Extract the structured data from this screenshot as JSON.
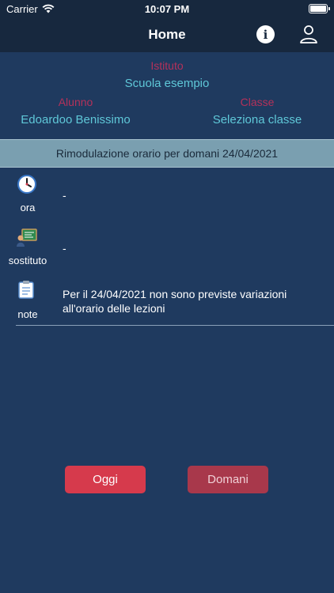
{
  "status_bar": {
    "carrier": "Carrier",
    "time": "10:07 PM"
  },
  "nav": {
    "title": "Home",
    "info_icon": "info-icon",
    "user_icon": "user-icon"
  },
  "header": {
    "istituto_label": "Istituto",
    "istituto_value": "Scuola esempio",
    "alunno_label": "Alunno",
    "alunno_value": "Edoardoo Benissimo",
    "classe_label": "Classe",
    "classe_value": "Seleziona classe"
  },
  "banner": {
    "text": "Rimodulazione orario per domani 24/04/2021"
  },
  "rows": {
    "ora": {
      "label": "ora",
      "value": "-",
      "icon": "clock-icon"
    },
    "sostituto": {
      "label": "sostituto",
      "value": "-",
      "icon": "teacher-icon"
    },
    "note": {
      "label": "note",
      "value": "Per il 24/04/2021 non sono previste variazioni all'orario delle lezioni",
      "icon": "clipboard-icon"
    }
  },
  "buttons": {
    "oggi": "Oggi",
    "domani": "Domani"
  },
  "colors": {
    "background": "#1f3a5f",
    "bar": "#17283e",
    "label_red": "#b4315a",
    "value_cyan": "#5fc8d8",
    "banner": "#7a9fb0",
    "oggi": "#d63a4c",
    "domani": "#a8384b"
  }
}
